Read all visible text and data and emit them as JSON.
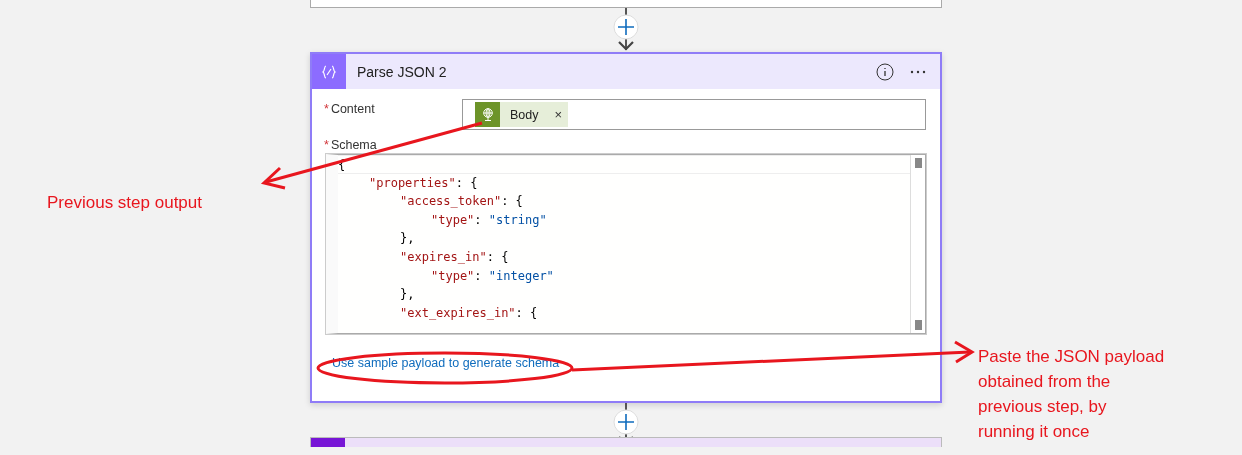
{
  "card": {
    "title": "Parse JSON 2",
    "fields": [
      {
        "label": "Content",
        "required_mark": "*",
        "kind": "tokens",
        "tokens": [
          {
            "label": "Body",
            "remove": "×"
          }
        ]
      },
      {
        "label": "Schema",
        "required_mark": "*",
        "kind": "code",
        "lines": [
          {
            "segments": [
              {
                "kind": "punct",
                "text": "{"
              }
            ],
            "children": [
              {
                "segments": [
                  {
                    "kind": "key",
                    "text": "\"properties\""
                  },
                  {
                    "kind": "punct",
                    "text": ": {"
                  }
                ],
                "children": [
                  {
                    "segments": [
                      {
                        "kind": "key",
                        "text": "\"access_token\""
                      },
                      {
                        "kind": "punct",
                        "text": ": {"
                      }
                    ],
                    "children": [
                      {
                        "segments": [
                          {
                            "kind": "key",
                            "text": "\"type\""
                          },
                          {
                            "kind": "punct",
                            "text": ": "
                          },
                          {
                            "kind": "value",
                            "text": "\"string\""
                          }
                        ]
                      }
                    ]
                  },
                  {
                    "segments": [
                      {
                        "kind": "punct",
                        "text": "},"
                      }
                    ]
                  },
                  {
                    "segments": [
                      {
                        "kind": "key",
                        "text": "\"expires_in\""
                      },
                      {
                        "kind": "punct",
                        "text": ": {"
                      }
                    ],
                    "children": [
                      {
                        "segments": [
                          {
                            "kind": "key",
                            "text": "\"type\""
                          },
                          {
                            "kind": "punct",
                            "text": ": "
                          },
                          {
                            "kind": "value",
                            "text": "\"integer\""
                          }
                        ]
                      }
                    ]
                  },
                  {
                    "segments": [
                      {
                        "kind": "punct",
                        "text": "},"
                      }
                    ]
                  },
                  {
                    "segments": [
                      {
                        "kind": "key",
                        "text": "\"ext_expires_in\""
                      },
                      {
                        "kind": "punct",
                        "text": ": {"
                      }
                    ]
                  }
                ]
              }
            ]
          }
        ]
      }
    ],
    "link": "Use sample payload to generate schema"
  },
  "annotations": [
    {
      "kind": "left",
      "lines": [
        "Previous step output"
      ]
    },
    {
      "kind": "right",
      "lines": [
        "Paste the JSON payload",
        "obtained from the",
        "previous step, by",
        "running it once"
      ]
    }
  ]
}
